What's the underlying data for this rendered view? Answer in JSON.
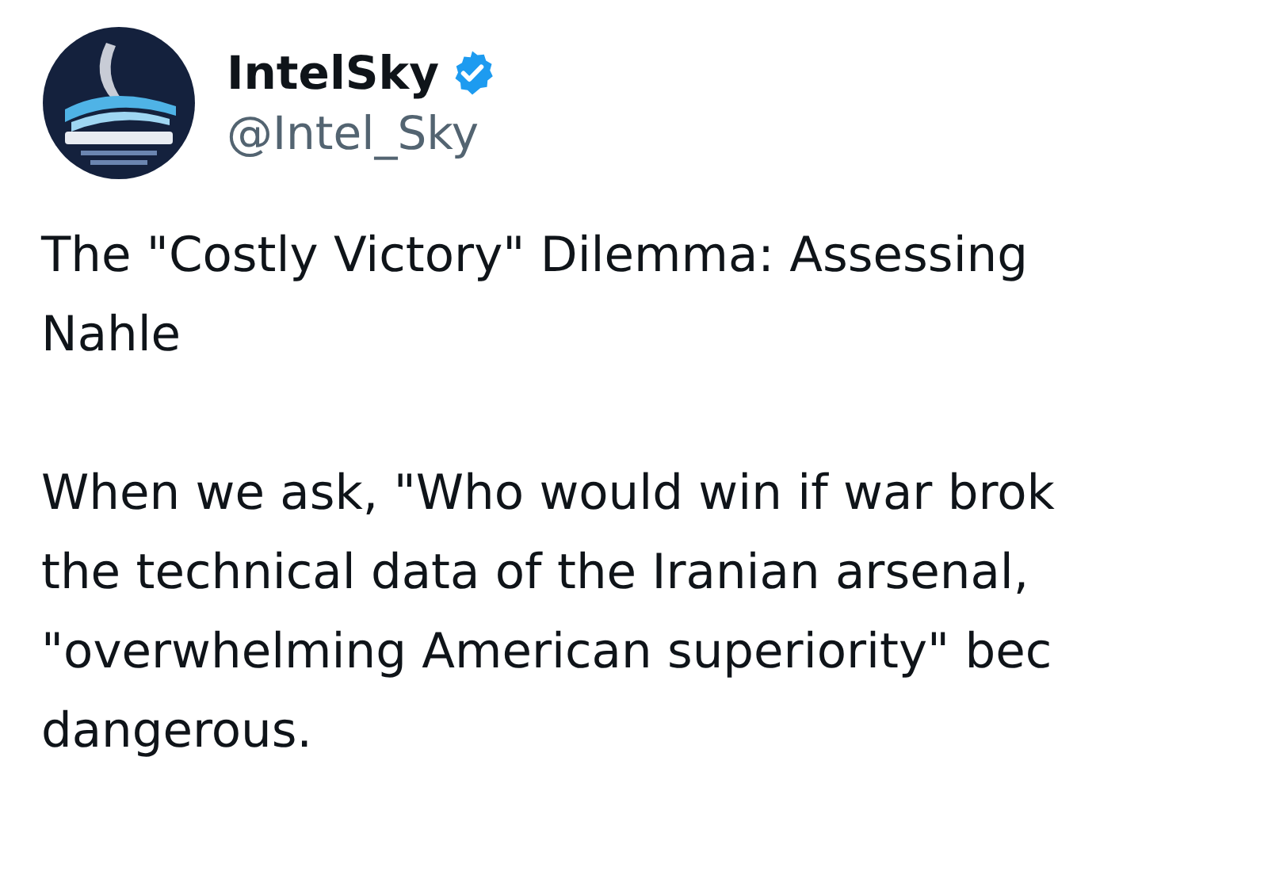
{
  "author": {
    "name": "IntelSky",
    "verified": true,
    "handle": "@Intel_Sky"
  },
  "post": {
    "paragraphs": [
      {
        "lines": [
          "The \"Costly Victory\" Dilemma: Assessing",
          "Nahle"
        ]
      },
      {
        "lines": [
          "When we ask, \"Who would win if war brok",
          "the technical data of the Iranian arsenal,",
          "\"overwhelming American superiority\" bec",
          "dangerous."
        ]
      }
    ]
  }
}
